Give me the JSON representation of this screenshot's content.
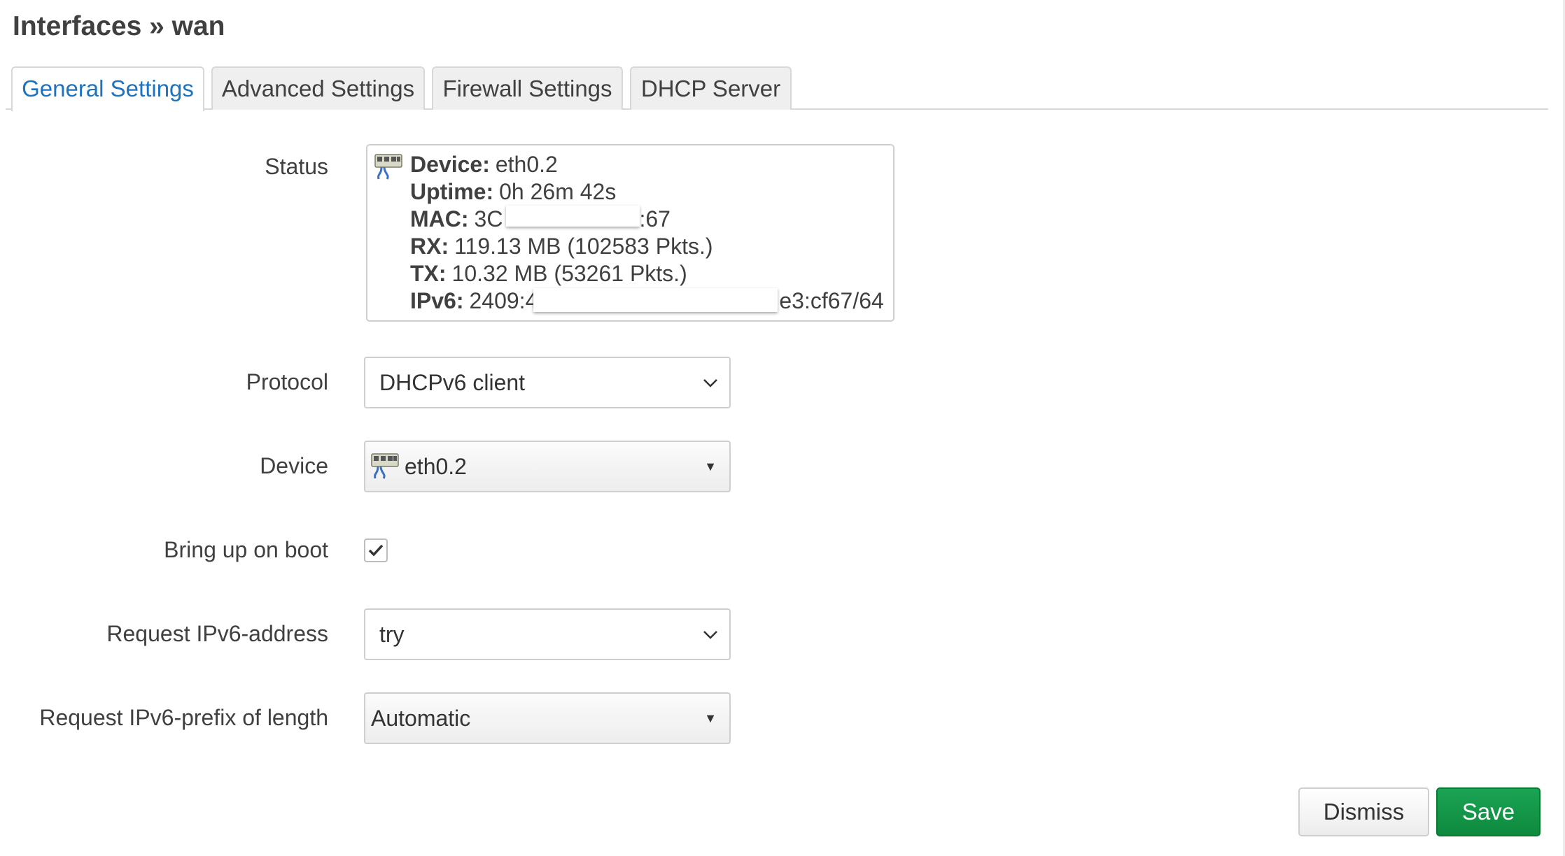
{
  "page": {
    "title": "Interfaces » wan"
  },
  "tabs": [
    {
      "label": "General Settings",
      "active": true
    },
    {
      "label": "Advanced Settings",
      "active": false
    },
    {
      "label": "Firewall Settings",
      "active": false
    },
    {
      "label": "DHCP Server",
      "active": false
    }
  ],
  "status": {
    "label": "Status",
    "icon": "ethernet-port-icon",
    "device_key": "Device:",
    "device": "eth0.2",
    "uptime_key": "Uptime:",
    "uptime": "0h 26m 42s",
    "mac_key": "MAC:",
    "mac_start": "3C",
    "mac_end": ":67",
    "rx_key": "RX:",
    "rx": "119.13 MB (102583 Pkts.)",
    "tx_key": "TX:",
    "tx": "10.32 MB (53261 Pkts.)",
    "ipv6_key": "IPv6:",
    "ipv6_start": "2409:4",
    "ipv6_end": "e3:cf67/64"
  },
  "fields": {
    "protocol": {
      "label": "Protocol",
      "value": "DHCPv6 client"
    },
    "device": {
      "label": "Device",
      "value": "eth0.2",
      "icon": "ethernet-port-icon"
    },
    "bring_up": {
      "label": "Bring up on boot",
      "checked": true
    },
    "req_addr": {
      "label": "Request IPv6-address",
      "value": "try"
    },
    "req_prefix": {
      "label": "Request IPv6-prefix of length",
      "value": "Automatic"
    }
  },
  "buttons": {
    "dismiss": "Dismiss",
    "save": "Save"
  },
  "colors": {
    "accent": "#1e73be",
    "save": "#0e8a3e"
  }
}
